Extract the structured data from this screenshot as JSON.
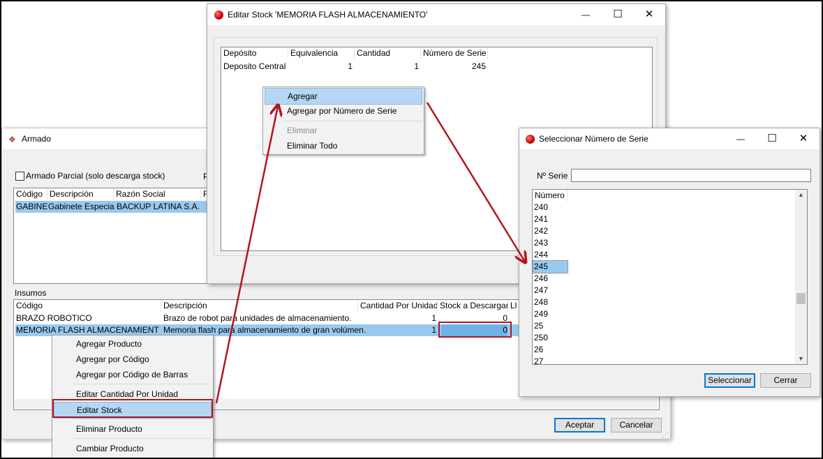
{
  "armado": {
    "title": "Armado",
    "parcial_label": "Armado Parcial (solo descarga stock)",
    "p_label": "P",
    "top_columns": [
      "Código",
      "Descripción",
      "Razón Social",
      "F"
    ],
    "top_row": [
      "GABINET",
      "Gabinete Especial",
      "BACKUP LATINA S.A."
    ],
    "insumos_label": "Insumos",
    "insumos_columns": [
      "Código",
      "Descripción",
      "Cantidad Por Unidad",
      "Stock a Descargar",
      "Ll"
    ],
    "insumos_rows": [
      {
        "codigo": "BRAZO ROBOTICO",
        "descripcion": "Brazo de robot para unidades de almacenamiento.",
        "cantidad": "1",
        "stock": "0"
      },
      {
        "codigo": "MEMORIA FLASH ALMACENAMIENTO",
        "descripcion": "Memoria flash para almacenamiento de gran volúmen.",
        "cantidad": "1",
        "stock": "0"
      }
    ],
    "aceptar": "Aceptar",
    "cancelar": "Cancelar"
  },
  "context_menu": {
    "agregar_producto": "Agregar Producto",
    "agregar_codigo": "Agregar por Código",
    "agregar_barras": "Agregar por Código de Barras",
    "editar_cantidad": "Editar Cantidad Por Unidad",
    "editar_stock": "Editar Stock",
    "eliminar_producto": "Eliminar Producto",
    "cambiar_producto": "Cambiar Producto"
  },
  "editar_stock": {
    "title": "Editar Stock 'MEMORIA FLASH ALMACENAMIENTO'",
    "columns": [
      "Depósito",
      "Equivalencia",
      "Cantidad",
      "Número de Serie"
    ],
    "row": {
      "deposito": "Deposito Central",
      "equivalencia": "1",
      "cantidad": "1",
      "serie": "245"
    },
    "menu": {
      "agregar": "Agregar",
      "agregar_serie": "Agregar por Número de Serie",
      "eliminar": "Eliminar",
      "eliminar_todo": "Eliminar Todo"
    }
  },
  "seleccionar": {
    "title": "Seleccionar Número de Serie",
    "serie_label": "Nº Serie",
    "serie_value": "",
    "column": "Número",
    "numbers": [
      "240",
      "241",
      "242",
      "243",
      "244",
      "245",
      "246",
      "247",
      "248",
      "249",
      "25",
      "250",
      "26",
      "27"
    ],
    "selected": "245",
    "seleccionar": "Seleccionar",
    "cerrar": "Cerrar"
  },
  "icons": {
    "close": "✕",
    "maximize": "☐",
    "minimize": "—"
  },
  "colors": {
    "selection": "#99c9ef",
    "annotation_red": "#b4141e",
    "default_button": "#0078d7"
  }
}
